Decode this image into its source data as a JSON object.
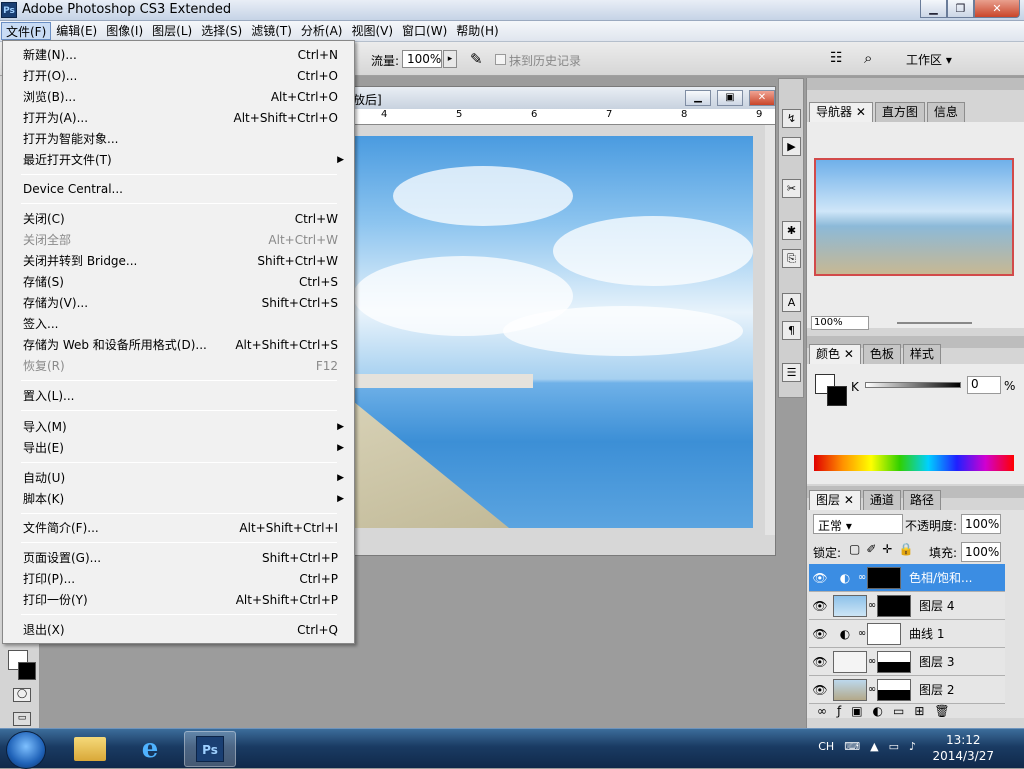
{
  "app": {
    "title": "Adobe Photoshop CS3 Extended",
    "logo": "Ps"
  },
  "window_buttons": {
    "min": "▁",
    "max": "❐",
    "close": "✕"
  },
  "menubar": [
    "文件(F)",
    "编辑(E)",
    "图像(I)",
    "图层(L)",
    "选择(S)",
    "滤镜(T)",
    "分析(A)",
    "视图(V)",
    "窗口(W)",
    "帮助(H)"
  ],
  "optbar": {
    "flow_label": "流量:",
    "flow_value": "100%",
    "airbrush_label": "抹到历史记录",
    "workspace": "工作区 ▾"
  },
  "document": {
    "title_suffix": "放后]",
    "ruler": [
      "4",
      "5",
      "6",
      "7",
      "8",
      "9"
    ]
  },
  "file_menu": [
    {
      "label": "新建(N)...",
      "shortcut": "Ctrl+N"
    },
    {
      "label": "打开(O)...",
      "shortcut": "Ctrl+O"
    },
    {
      "label": "浏览(B)...",
      "shortcut": "Alt+Ctrl+O"
    },
    {
      "label": "打开为(A)...",
      "shortcut": "Alt+Shift+Ctrl+O"
    },
    {
      "label": "打开为智能对象...",
      "shortcut": ""
    },
    {
      "label": "最近打开文件(T)",
      "shortcut": "",
      "submenu": true
    },
    {
      "label": "Device Central...",
      "shortcut": ""
    },
    {
      "label": "关闭(C)",
      "shortcut": "Ctrl+W"
    },
    {
      "label": "关闭全部",
      "shortcut": "Alt+Ctrl+W",
      "disabled": true
    },
    {
      "label": "关闭并转到 Bridge...",
      "shortcut": "Shift+Ctrl+W"
    },
    {
      "label": "存储(S)",
      "shortcut": "Ctrl+S"
    },
    {
      "label": "存储为(V)...",
      "shortcut": "Shift+Ctrl+S"
    },
    {
      "label": "签入...",
      "shortcut": ""
    },
    {
      "label": "存储为 Web 和设备所用格式(D)...",
      "shortcut": "Alt+Shift+Ctrl+S"
    },
    {
      "label": "恢复(R)",
      "shortcut": "F12",
      "disabled": true
    },
    {
      "label": "置入(L)...",
      "shortcut": ""
    },
    {
      "label": "导入(M)",
      "shortcut": "",
      "submenu": true
    },
    {
      "label": "导出(E)",
      "shortcut": "",
      "submenu": true
    },
    {
      "label": "自动(U)",
      "shortcut": "",
      "submenu": true
    },
    {
      "label": "脚本(K)",
      "shortcut": "",
      "submenu": true
    },
    {
      "label": "文件简介(F)...",
      "shortcut": "Alt+Shift+Ctrl+I"
    },
    {
      "label": "页面设置(G)...",
      "shortcut": "Shift+Ctrl+P"
    },
    {
      "label": "打印(P)...",
      "shortcut": "Ctrl+P"
    },
    {
      "label": "打印一份(Y)",
      "shortcut": "Alt+Shift+Ctrl+P"
    },
    {
      "label": "退出(X)",
      "shortcut": "Ctrl+Q"
    }
  ],
  "navigator": {
    "tabs": [
      "导航器",
      "直方图",
      "信息"
    ],
    "zoom": "100%"
  },
  "color": {
    "tabs": [
      "颜色",
      "色板",
      "样式"
    ],
    "channel": "K",
    "value": "0",
    "unit": "%"
  },
  "layers": {
    "tabs": [
      "图层",
      "通道",
      "路径"
    ],
    "blend": "正常 ▾",
    "opacity_label": "不透明度:",
    "opacity": "100%",
    "lock_label": "锁定:",
    "fill_label": "填充:",
    "fill": "100%",
    "items": [
      {
        "name": "色相/饱和...",
        "selected": true
      },
      {
        "name": "图层 4"
      },
      {
        "name": "曲线 1"
      },
      {
        "name": "图层 3"
      },
      {
        "name": "图层 2"
      }
    ]
  },
  "taskbar": {
    "lang": "CH",
    "time": "13:12",
    "date": "2014/3/27"
  }
}
